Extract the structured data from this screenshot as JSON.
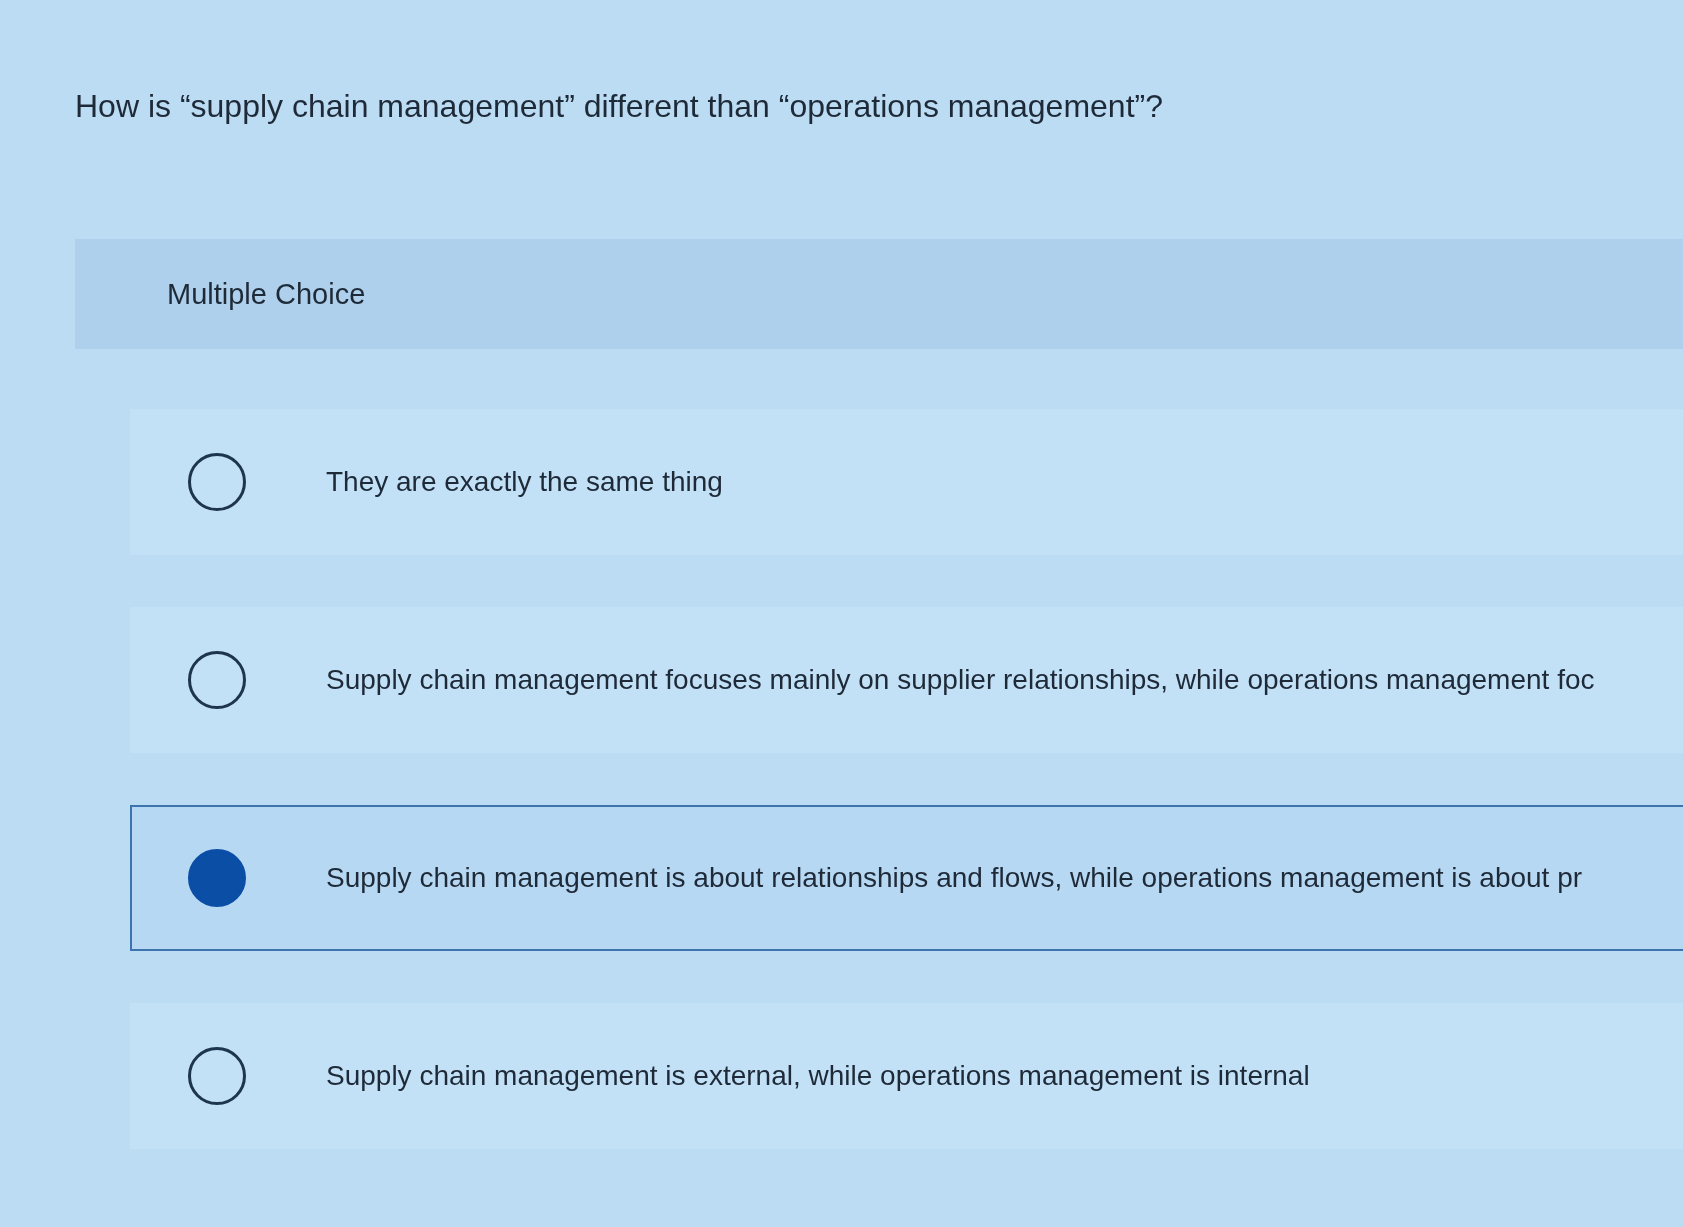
{
  "question": "How is “supply chain management” different than “operations management”?",
  "section_label": "Multiple Choice",
  "options": [
    {
      "text": "They are exactly the same thing",
      "selected": false
    },
    {
      "text": "Supply chain management focuses mainly on supplier relationships, while operations management foc",
      "selected": false
    },
    {
      "text": "Supply chain management is about relationships and flows, while operations management is about pr",
      "selected": true
    },
    {
      "text": "Supply chain management is external, while operations management is internal",
      "selected": false
    }
  ]
}
